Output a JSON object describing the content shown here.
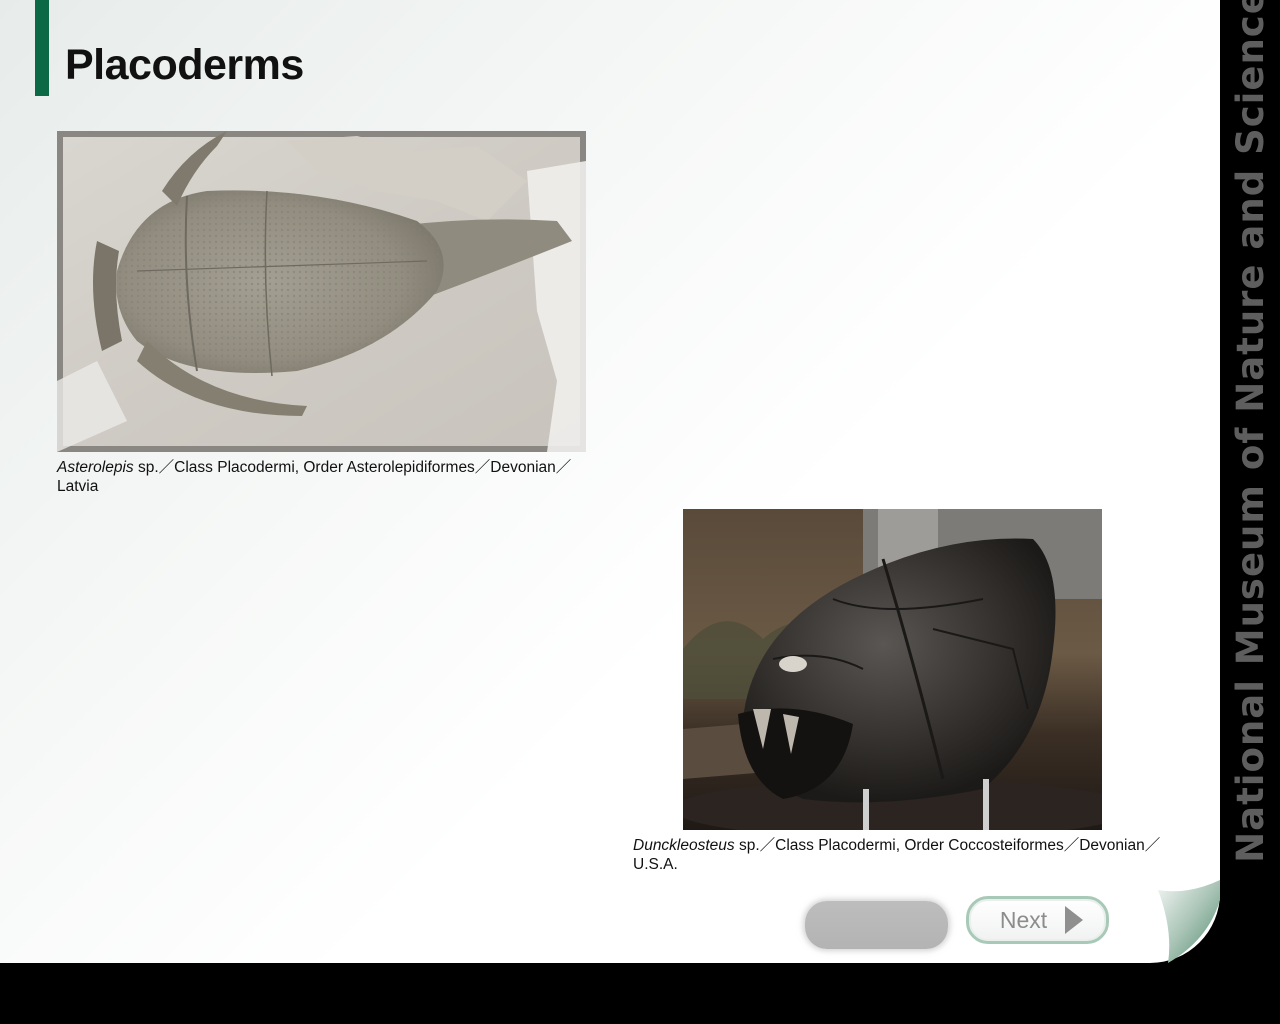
{
  "page": {
    "title": "Placoderms",
    "side_label": "National Museum of Nature and Science",
    "accent_color": "#0b6a45"
  },
  "photos": [
    {
      "name": "Asterolepis fossil",
      "caption_italic": "Asterolepis",
      "caption_rest": " sp.／Class Placodermi, Order Asterolepidiformes／Devonian／Latvia"
    },
    {
      "name": "Dunckleosteus model",
      "caption_italic": "Dunckleosteus",
      "caption_rest": " sp.／Class Placodermi, Order Coccosteiformes／Devonian／U.S.A."
    }
  ],
  "nav": {
    "prev_label": "",
    "next_label": "Next",
    "next_icon": "triangle-right-icon"
  }
}
